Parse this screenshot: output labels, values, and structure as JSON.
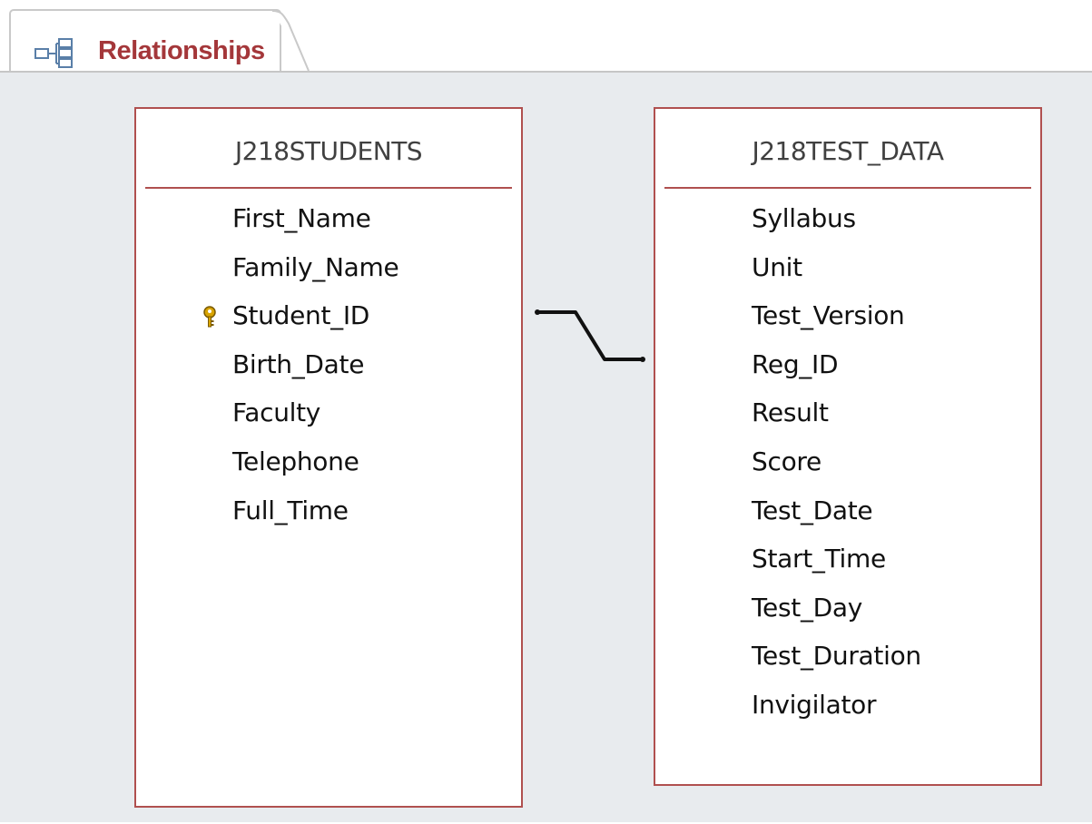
{
  "colors": {
    "accent": "#a4373a",
    "table_border": "#b0504f",
    "workspace_bg": "#e8ebee",
    "key": "#d9a400"
  },
  "tab": {
    "label": "Relationships",
    "icon": "relationships-icon"
  },
  "tables": [
    {
      "name": "J218STUDENTS",
      "fields": [
        {
          "name": "First_Name",
          "primary_key": false
        },
        {
          "name": "Family_Name",
          "primary_key": false
        },
        {
          "name": "Student_ID",
          "primary_key": true
        },
        {
          "name": "Birth_Date",
          "primary_key": false
        },
        {
          "name": "Faculty",
          "primary_key": false
        },
        {
          "name": "Telephone",
          "primary_key": false
        },
        {
          "name": "Full_Time",
          "primary_key": false
        }
      ]
    },
    {
      "name": "J218TEST_DATA",
      "fields": [
        {
          "name": "Syllabus",
          "primary_key": false
        },
        {
          "name": "Unit",
          "primary_key": false
        },
        {
          "name": "Test_Version",
          "primary_key": false
        },
        {
          "name": "Reg_ID",
          "primary_key": false
        },
        {
          "name": "Result",
          "primary_key": false
        },
        {
          "name": "Score",
          "primary_key": false
        },
        {
          "name": "Test_Date",
          "primary_key": false
        },
        {
          "name": "Start_Time",
          "primary_key": false
        },
        {
          "name": "Test_Day",
          "primary_key": false
        },
        {
          "name": "Test_Duration",
          "primary_key": false
        },
        {
          "name": "Invigilator",
          "primary_key": false
        }
      ]
    }
  ],
  "relationship": {
    "from_table": "J218STUDENTS",
    "from_field": "Student_ID",
    "to_table": "J218TEST_DATA",
    "to_field": "Reg_ID"
  }
}
